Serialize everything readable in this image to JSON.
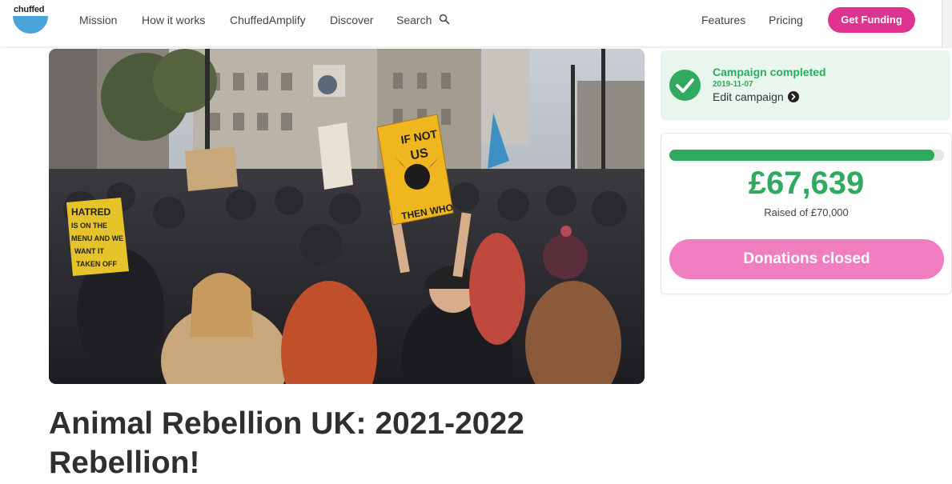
{
  "header": {
    "logo_text": "chuffed",
    "nav": [
      "Mission",
      "How it works",
      "ChuffedAmplify",
      "Discover",
      "Search"
    ],
    "right_nav": [
      "Features",
      "Pricing"
    ],
    "cta": "Get Funding"
  },
  "hero": {
    "signs": {
      "sign1": [
        "IF NOT",
        "US",
        "THEN WHO"
      ],
      "sign2": [
        "HATRED",
        "IS ON THE",
        "MENU AND WE",
        "WANT IT",
        "TAKEN OFF"
      ]
    }
  },
  "campaign": {
    "title": "Animal Rebellion UK: 2021-2022 Rebellion!"
  },
  "status": {
    "title": "Campaign completed",
    "date": "2019-11-07",
    "edit_label": "Edit campaign"
  },
  "funding": {
    "amount": "£67,639",
    "raised_label": "Raised of £70,000",
    "progress_fraction": 0.966,
    "button": "Donations closed"
  },
  "colors": {
    "brand_pink": "#e0338f",
    "success_green": "#2faa5e",
    "closed_pink": "#f07ec0",
    "logo_blue": "#4aa3d9"
  }
}
